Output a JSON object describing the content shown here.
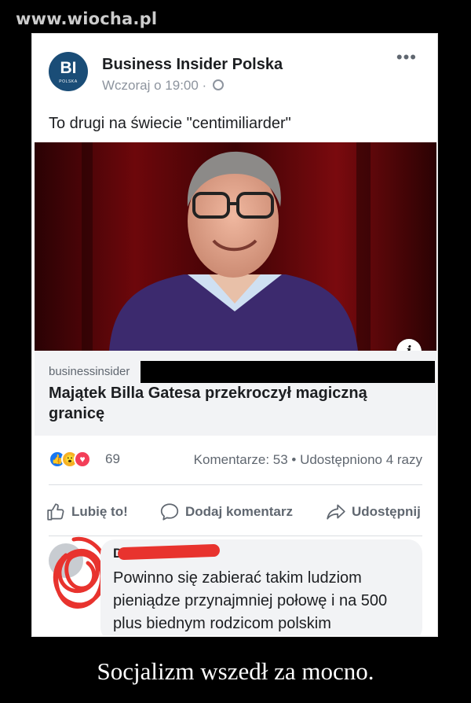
{
  "watermark": "www.wiocha.pl",
  "post": {
    "avatar_text": "BI",
    "avatar_subtext": "POLSKA",
    "page_name": "Business Insider Polska",
    "timestamp": "Wczoraj o 19:00 · ",
    "more_label": "•••",
    "text": "To drugi na świecie \"centimiliarder\"",
    "info_label": "i"
  },
  "link": {
    "domain": "businessinsider",
    "title": "Majątek Billa Gatesa przekroczył magiczną granicę"
  },
  "reactions": {
    "count": "69",
    "stats": "Komentarze: 53 • Udostępniono 4 razy"
  },
  "actions": {
    "like": "Lubię to!",
    "comment": "Dodaj komentarz",
    "share": "Udostępnij"
  },
  "comment": {
    "author": "D",
    "text": "Powinno się zabierać takim ludziom pieniądze przynajmniej połowę i na 500 plus biednym rodzicom polskim"
  },
  "caption": "Socjalizm wszedł za mocno.",
  "colors": {
    "brand_blue": "#1877f2",
    "avatar_bg": "#1a4d77",
    "annotation_red": "#e8332e"
  }
}
